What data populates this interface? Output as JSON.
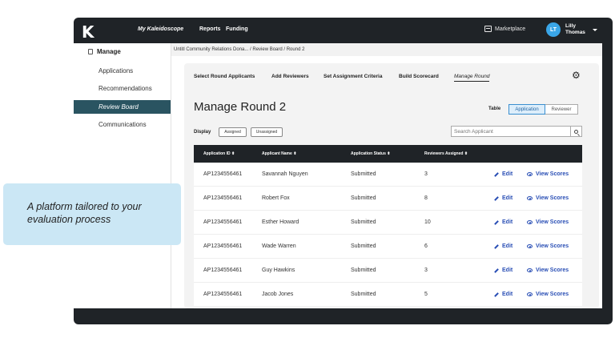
{
  "topbar": {
    "logo": "K",
    "my_kaleidoscope": "My Kaleidoscope",
    "reports": "Reports",
    "funding": "Funding",
    "marketplace": "Marketplace",
    "avatar_initials": "LT",
    "user_first": "Lilly",
    "user_last": "Thomas"
  },
  "sidebar": {
    "heading": "Manage",
    "items": [
      {
        "label": "Applications"
      },
      {
        "label": "Recommendations"
      },
      {
        "label": "Review Board"
      },
      {
        "label": "Communications"
      }
    ]
  },
  "breadcrumb": "Untitl Community Relations Dona...  /  Review Board  /  Round 2",
  "tabs": [
    {
      "label": "Select Round Applicants"
    },
    {
      "label": "Add Reviewers"
    },
    {
      "label": "Set Assignment Criteria"
    },
    {
      "label": "Build Scorecard"
    },
    {
      "label": "Manage Round"
    }
  ],
  "page_title": "Manage Round 2",
  "view_toggle": {
    "label": "Table",
    "options": [
      "Application",
      "Reviewer"
    ],
    "selected": "Application"
  },
  "display": {
    "label": "Display",
    "chips": [
      "Assigned",
      "Unassigned"
    ]
  },
  "search": {
    "placeholder": "Search Applicant"
  },
  "table": {
    "headers": [
      "Application ID",
      "Applicant Name",
      "Application Status",
      "Reviewers Assigned"
    ],
    "edit_label": "Edit",
    "view_label": "View Scores",
    "rows": [
      {
        "id": "AP1234556461",
        "name": "Savannah Nguyen",
        "status": "Submitted",
        "reviewers": "3"
      },
      {
        "id": "AP1234556461",
        "name": "Robert Fox",
        "status": "Submitted",
        "reviewers": "8"
      },
      {
        "id": "AP1234556461",
        "name": "Esther Howard",
        "status": "Submitted",
        "reviewers": "10"
      },
      {
        "id": "AP1234556461",
        "name": "Wade Warren",
        "status": "Submitted",
        "reviewers": "6"
      },
      {
        "id": "AP1234556461",
        "name": "Guy Hawkins",
        "status": "Submitted",
        "reviewers": "3"
      },
      {
        "id": "AP1234556461",
        "name": "Jacob Jones",
        "status": "Submitted",
        "reviewers": "5"
      }
    ]
  },
  "callout": {
    "line1": "A platform tailored to your",
    "line2": "evaluation process"
  },
  "colors": {
    "accent": "#2a5461",
    "link": "#2a4fb5",
    "callout_bg": "#cbe7f5",
    "frame": "#1f2327"
  }
}
